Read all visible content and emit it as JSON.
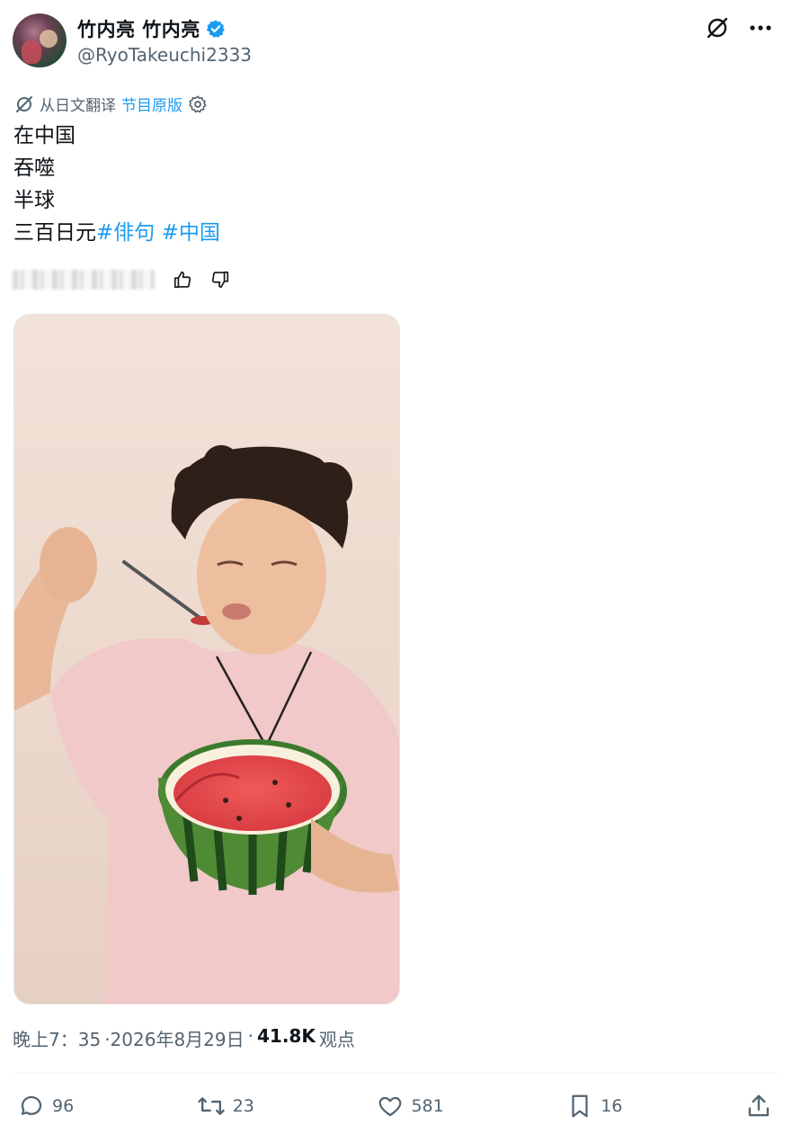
{
  "author": {
    "display_name": "竹内亮 竹内亮",
    "handle": "@RyoTakeuchi2333"
  },
  "translation": {
    "label": "从日文翻译",
    "show_original": "节目原版"
  },
  "tweet": {
    "lines": [
      "在中国",
      "吞噬",
      "半球",
      "三百日元"
    ],
    "hashtags": [
      "#俳句",
      "#中国"
    ]
  },
  "meta": {
    "time": "晚上7：35",
    "date": "·2026年8月29日",
    "separator": "·",
    "views_count": "41.8K",
    "views_label": "观点"
  },
  "actions": {
    "replies": "96",
    "retweets": "23",
    "likes": "581",
    "bookmarks": "16"
  },
  "colors": {
    "accent": "#1d9bf0",
    "muted": "#536471"
  }
}
